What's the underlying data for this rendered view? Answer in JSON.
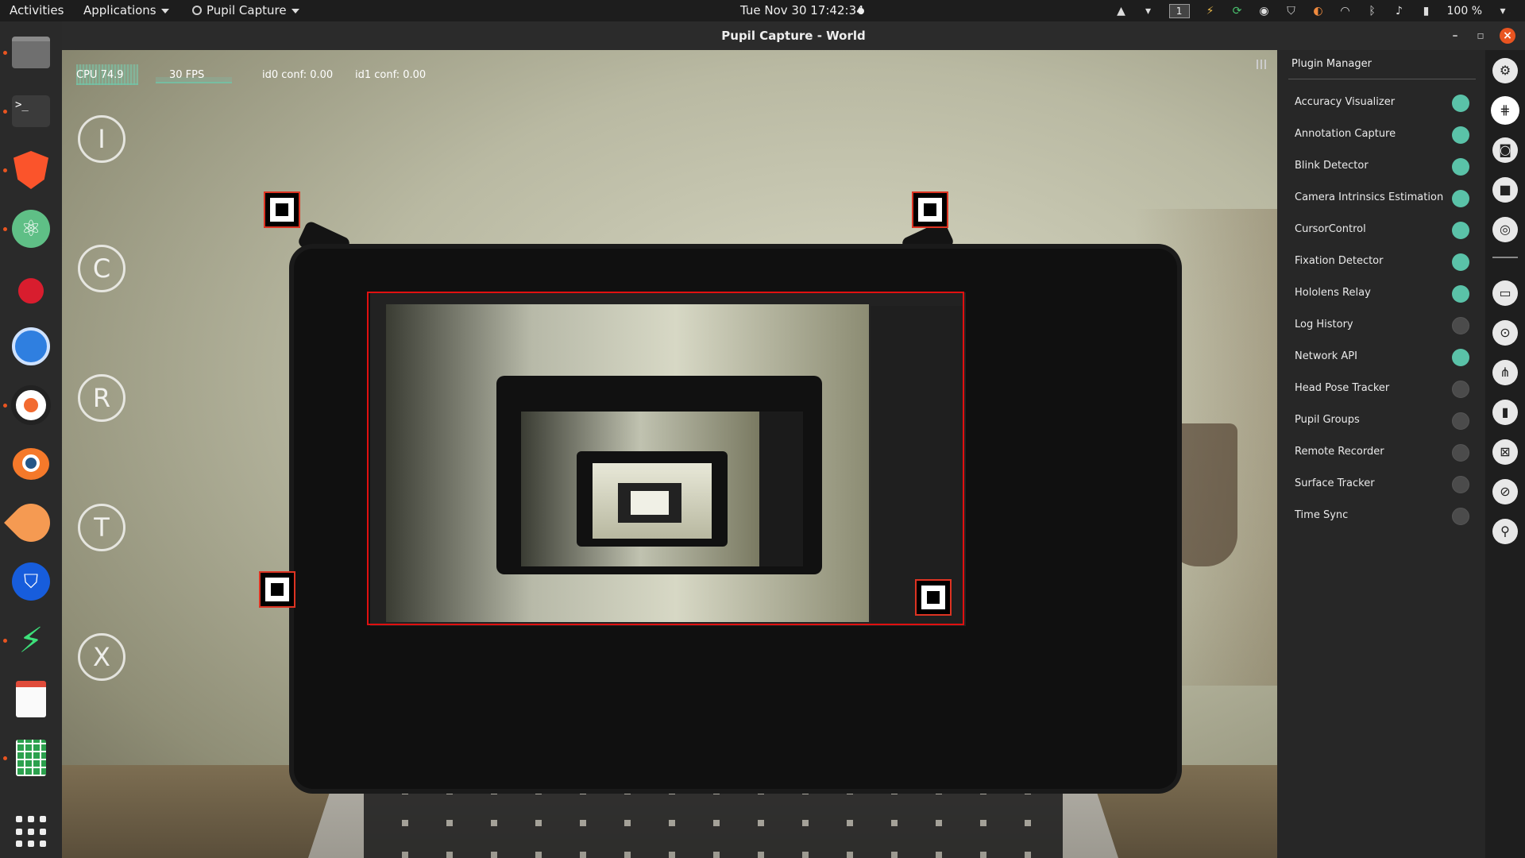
{
  "topbar": {
    "activities": "Activities",
    "applications": "Applications",
    "app_menu": "Pupil Capture",
    "datetime": "Tue Nov 30  17:42:34",
    "workspace": "1",
    "battery": "100 %"
  },
  "window": {
    "title": "Pupil Capture - World"
  },
  "hud": {
    "cpu": "CPU 74.9",
    "fps": "30 FPS",
    "id0_conf": "id0 conf: 0.00",
    "id1_conf": "id1 conf: 0.00"
  },
  "quickbar": {
    "buttons": [
      "I",
      "C",
      "R",
      "T",
      "X"
    ]
  },
  "plugin_manager": {
    "title": "Plugin Manager",
    "plugins": [
      {
        "label": "Accuracy Visualizer",
        "enabled": true
      },
      {
        "label": "Annotation Capture",
        "enabled": true
      },
      {
        "label": "Blink Detector",
        "enabled": true
      },
      {
        "label": "Camera Intrinsics Estimation",
        "enabled": true
      },
      {
        "label": "CursorControl",
        "enabled": true
      },
      {
        "label": "Fixation Detector",
        "enabled": true
      },
      {
        "label": "Hololens Relay",
        "enabled": true
      },
      {
        "label": "Log History",
        "enabled": false
      },
      {
        "label": "Network API",
        "enabled": true
      },
      {
        "label": "Head Pose Tracker",
        "enabled": false
      },
      {
        "label": "Pupil Groups",
        "enabled": false
      },
      {
        "label": "Remote Recorder",
        "enabled": false
      },
      {
        "label": "Surface Tracker",
        "enabled": false
      },
      {
        "label": "Time Sync",
        "enabled": false
      }
    ]
  },
  "iconbar": {
    "icons": [
      "gear-icon",
      "plugin-manager-icon",
      "camera-icon",
      "video-camera-icon",
      "record-target-icon",
      "cast-icon",
      "calibration-icon",
      "network-icon",
      "bookmark-icon",
      "surface-icon",
      "eye-hidden-icon",
      "link-icon"
    ]
  },
  "colors": {
    "toggle_on": "#5ac2a8",
    "toggle_off": "#4b4b4b",
    "surface_outline": "#e01010",
    "ubuntu_orange": "#e95420"
  }
}
